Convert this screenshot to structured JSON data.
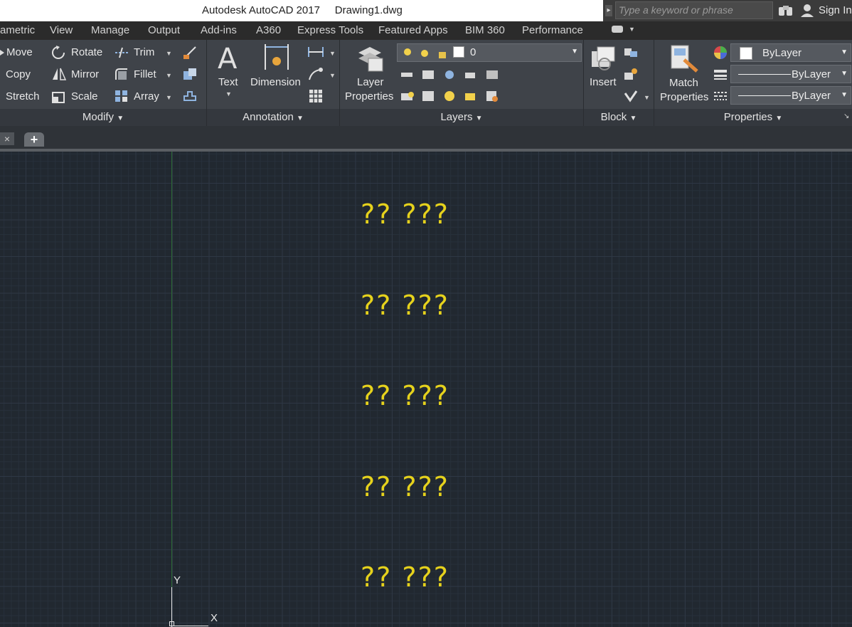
{
  "window": {
    "title": "Autodesk AutoCAD 2017     Drawing1.dwg",
    "search_placeholder": "Type a keyword or phrase",
    "sign_in": "Sign In"
  },
  "ribbon_tabs": [
    "ametric",
    "View",
    "Manage",
    "Output",
    "Add-ins",
    "A360",
    "Express Tools",
    "Featured Apps",
    "BIM 360",
    "Performance"
  ],
  "modify": {
    "move": "Move",
    "rotate": "Rotate",
    "trim": "Trim",
    "copy": "Copy",
    "mirror": "Mirror",
    "fillet": "Fillet",
    "stretch": "Stretch",
    "scale": "Scale",
    "array": "Array",
    "panel": "Modify"
  },
  "annotation": {
    "text": "Text",
    "dimension": "Dimension",
    "panel": "Annotation"
  },
  "layers": {
    "layer_properties_1": "Layer",
    "layer_properties_2": "Properties",
    "current_layer": "0",
    "panel": "Layers"
  },
  "block": {
    "insert": "Insert",
    "panel": "Block"
  },
  "properties": {
    "match_1": "Match",
    "match_2": "Properties",
    "color": "ByLayer",
    "linetype": "ByLayer",
    "lineweight": "ByLayer",
    "panel": "Properties"
  },
  "drawing": {
    "text_rows": [
      "?? ???",
      "?? ???",
      "?? ???",
      "?? ???",
      "?? ???"
    ],
    "text_color": "#e6d21c"
  },
  "ucs": {
    "y": "Y",
    "x": "X"
  },
  "colors": {
    "background": "#212830",
    "ribbon": "#3f4349",
    "axis_green": "#2c6a35"
  }
}
